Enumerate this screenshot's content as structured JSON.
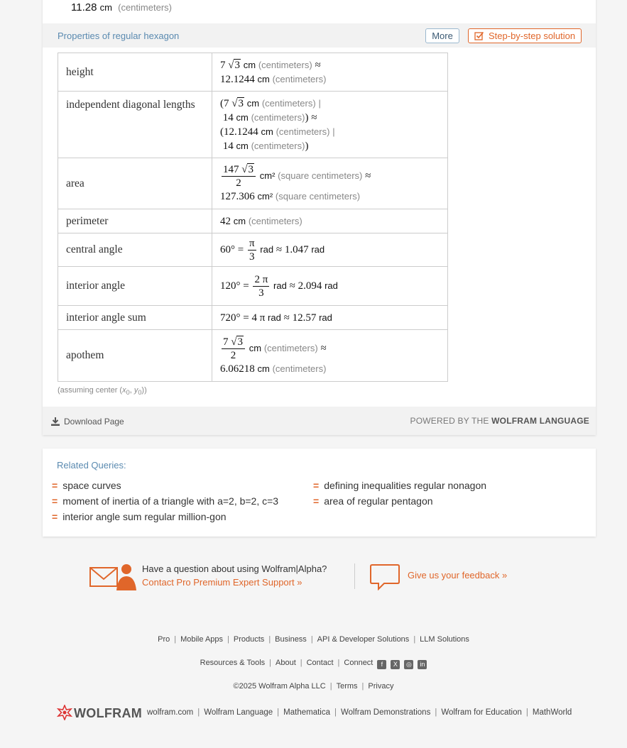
{
  "prev": {
    "value": "11.28",
    "unit": "cm",
    "note": "(centimeters)"
  },
  "pod": {
    "title": "Properties of regular hexagon",
    "more_label": "More",
    "step_label": "Step-by-step solution",
    "rows": {
      "height": {
        "label": "height",
        "coef": "7",
        "rad": "3",
        "unit": "cm",
        "note": "(centimeters)",
        "approx": "12.1244",
        "approx_unit": "cm",
        "approx_note": "(centimeters)"
      },
      "diagonals": {
        "label": "independent diagonal lengths",
        "d1_coef": "7",
        "d1_rad": "3",
        "d1_unit": "cm",
        "d1_note": "(centimeters)",
        "d2": "14",
        "d2_unit": "cm",
        "d2_note": "(centimeters)",
        "a1": "12.1244",
        "a1_unit": "cm",
        "a1_note": "(centimeters)",
        "a2": "14",
        "a2_unit": "cm",
        "a2_note": "(centimeters)"
      },
      "area": {
        "label": "area",
        "num_coef": "147",
        "num_rad": "3",
        "den": "2",
        "unit": "cm²",
        "note": "(square centimeters)",
        "approx": "127.306",
        "approx_unit": "cm²",
        "approx_note": "(square centimeters)"
      },
      "perimeter": {
        "label": "perimeter",
        "value": "42",
        "unit": "cm",
        "note": "(centimeters)"
      },
      "central": {
        "label": "central angle",
        "deg": "60°",
        "num": "π",
        "den": "3",
        "unit": "rad",
        "approx": "1.047",
        "approx_unit": "rad"
      },
      "interior": {
        "label": "interior angle",
        "deg": "120°",
        "num": "2 π",
        "den": "3",
        "unit": "rad",
        "approx": "2.094",
        "approx_unit": "rad"
      },
      "interior_sum": {
        "label": "interior angle sum",
        "deg": "720°",
        "val": "4 π",
        "unit": "rad",
        "approx": "12.57",
        "approx_unit": "rad"
      },
      "apothem": {
        "label": "apothem",
        "num_coef": "7",
        "num_rad": "3",
        "den": "2",
        "unit": "cm",
        "note": "(centimeters)",
        "approx": "6.06218",
        "approx_unit": "cm",
        "approx_note": "(centimeters)"
      }
    },
    "assumption_prefix": "(assuming center (",
    "x0": "x",
    "sub0": "0",
    "comma": ", ",
    "y0": "y",
    "sub1": "0",
    "assumption_suffix": "))",
    "download_label": "Download Page",
    "powered_prefix": "POWERED BY THE",
    "powered_brand": "WOLFRAM LANGUAGE"
  },
  "related": {
    "title": "Related Queries:",
    "items": [
      "space curves",
      "defining inequalities regular nonagon",
      "moment of inertia of a triangle with a=2, b=2, c=3",
      "area of regular pentagon",
      "interior angle sum regular million-gon"
    ]
  },
  "support": {
    "question": "Have a question about using Wolfram|Alpha?",
    "contact": "Contact Pro Premium Expert Support »",
    "feedback": "Give us your feedback »"
  },
  "footer": {
    "row1": [
      "Pro",
      "Mobile Apps",
      "Products",
      "Business",
      "API & Developer Solutions",
      "LLM Solutions"
    ],
    "row2": [
      "Resources & Tools",
      "About",
      "Contact",
      "Connect"
    ],
    "social": [
      "f",
      "X",
      "◎",
      "in"
    ],
    "copyright": "©2025 Wolfram Alpha LLC",
    "terms": "Terms",
    "privacy": "Privacy",
    "brand": "WOLFRAM",
    "sites": [
      "wolfram.com",
      "Wolfram Language",
      "Mathematica",
      "Wolfram Demonstrations",
      "Wolfram for Education",
      "MathWorld"
    ]
  }
}
